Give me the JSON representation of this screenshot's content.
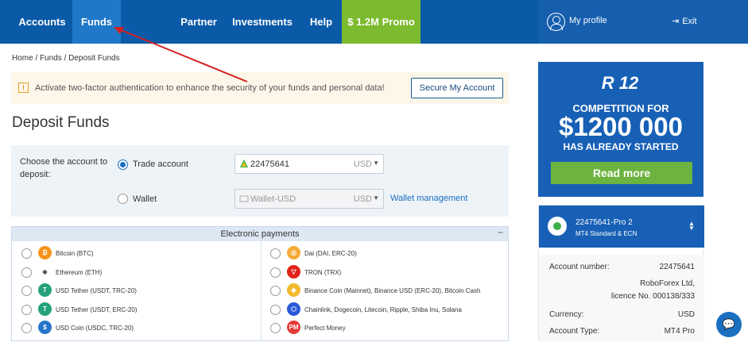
{
  "nav": {
    "items": [
      {
        "label": "Accounts"
      },
      {
        "label": "Funds"
      },
      {
        "label": "Partner"
      },
      {
        "label": "Investments"
      },
      {
        "label": "Help"
      }
    ],
    "promo_label": "$ 1.2M Promo",
    "profile_label": "My profile",
    "exit_label": "Exit"
  },
  "breadcrumb": "Home / Funds / Deposit Funds",
  "alert": {
    "text": "Activate two-factor authentication to enhance the security of your funds and personal data!",
    "button": "Secure My Account"
  },
  "page_title": "Deposit Funds",
  "deposit": {
    "choose_label": "Choose the account to deposit:",
    "trade_label": "Trade account",
    "trade_account": "22475641",
    "trade_currency": "USD",
    "wallet_label": "Wallet",
    "wallet_account": "Wallet-USD",
    "wallet_currency": "USD",
    "wallet_link": "Wallet management"
  },
  "payments": {
    "title": "Electronic payments",
    "collapse": "−",
    "left": [
      {
        "name": "Bitcoin (BTC)",
        "icon": "bitcoin-icon",
        "color": "#f7931a",
        "glyph": "₿"
      },
      {
        "name": "Ethereum (ETH)",
        "icon": "ethereum-icon",
        "color": "#ffffff",
        "glyph": "◆"
      },
      {
        "name": "USD Tether (USDT, TRC-20)",
        "icon": "tether-icon",
        "color": "#26a17b",
        "glyph": "T"
      },
      {
        "name": "USD Tether (USDT, ERC-20)",
        "icon": "tether-icon",
        "color": "#26a17b",
        "glyph": "T"
      },
      {
        "name": "USD Coin (USDC, TRC-20)",
        "icon": "usdc-icon",
        "color": "#2775ca",
        "glyph": "$"
      }
    ],
    "right": [
      {
        "name": "Dai (DAI, ERC-20)",
        "icon": "dai-icon",
        "color": "#f5ac37",
        "glyph": "◎"
      },
      {
        "name": "TRON (TRX)",
        "icon": "tron-icon",
        "color": "#e2231a",
        "glyph": "▽"
      },
      {
        "name": "Binance Coin (Mainnet), Binance USD (ERC-20), Bitcoin Cash",
        "icon": "binance-icon",
        "color": "#f3ba2f",
        "glyph": "◆"
      },
      {
        "name": "Chainlink, Dogecoin, Litecoin, Ripple, Shiba Inu, Solana",
        "icon": "chainlink-icon",
        "color": "#2a5ada",
        "glyph": "⬡"
      },
      {
        "name": "Perfect Money",
        "icon": "perfect-money-icon",
        "color": "#e53935",
        "glyph": "PM"
      }
    ]
  },
  "promo": {
    "logo": "R 12",
    "line1": "COMPETITION FOR",
    "amount": "$1200 000",
    "line2": "HAS ALREADY STARTED",
    "button": "Read more"
  },
  "account": {
    "name": "22475641-Pro 2",
    "type": "MT4 Standard & ECN",
    "rows": [
      {
        "label": "Account number:",
        "value": "22475641"
      },
      {
        "label": "",
        "value": "RoboForex Ltd,"
      },
      {
        "label": "",
        "value": "licence No. 000138/333"
      },
      {
        "label": "Currency:",
        "value": "USD"
      },
      {
        "label": "Account Type:",
        "value": "MT4 Pro"
      }
    ]
  },
  "colors": {
    "nav": "#0b5aa8",
    "active": "#1f79c8",
    "promo_green": "#7cba2f",
    "annotation_arrow": "#d42020"
  }
}
